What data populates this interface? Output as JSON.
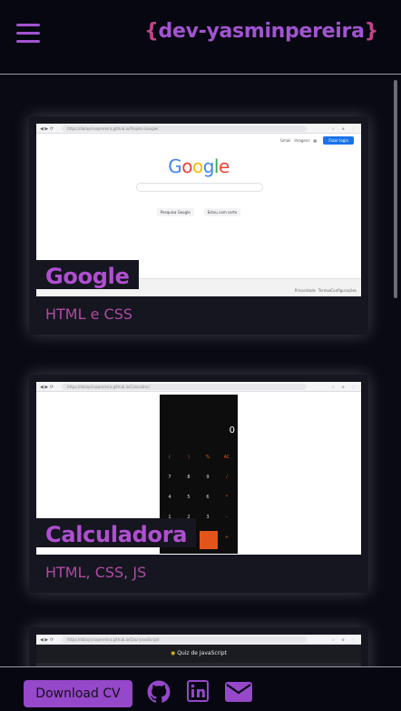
{
  "header": {
    "brand_open": "{",
    "brand_name": "dev-yasminpereira",
    "brand_close": "}"
  },
  "projects": [
    {
      "title": "Google",
      "tech": "HTML e CSS",
      "preview": {
        "url": "https://dalaysinaprereira.github.io/Projeto-Google/",
        "top_links": [
          "Gmail",
          "Imagens"
        ],
        "signin": "Fazer login",
        "logo": "Google",
        "buttons": [
          "Pesquisa Google",
          "Estou com sorte"
        ],
        "footer_links": [
          "Privacidade",
          "Termos",
          "Configurações"
        ]
      }
    },
    {
      "title": "Calculadora",
      "tech": "HTML, CSS, JS",
      "preview": {
        "url": "https://dalaysinaprereira.github.io/Calculator/",
        "display": "0",
        "keys": [
          "(",
          ")",
          "%",
          "AC",
          "7",
          "8",
          "9",
          "/",
          "4",
          "5",
          "6",
          "*",
          "1",
          "2",
          "3",
          "-",
          "=",
          "+"
        ]
      }
    },
    {
      "title": "",
      "tech": "",
      "preview": {
        "url": "https://dalaysinaprereira.github.io/Quiz-JavaScript/",
        "heading": "Quiz de JavaScript"
      }
    }
  ],
  "footer": {
    "cv_label": "Download CV",
    "icons": [
      "github-icon",
      "linkedin-icon",
      "mail-icon"
    ]
  },
  "colors": {
    "accent": "#a254d1",
    "brace": "#c0458a",
    "tech_text": "#b04aa6",
    "background": "#090a12",
    "card": "#15161f"
  }
}
